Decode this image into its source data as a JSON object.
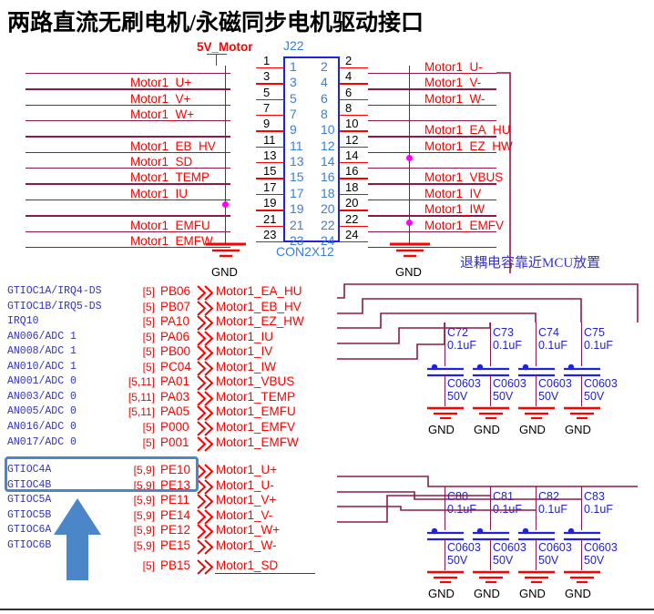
{
  "title": "两路直流无刷电机/永磁同步电机驱动接口",
  "power": {
    "label": "5V_Motor"
  },
  "connector": {
    "designator": "J22",
    "footprint": "CON2X12",
    "left_pins": [
      "1",
      "3",
      "5",
      "7",
      "9",
      "11",
      "13",
      "15",
      "17",
      "19",
      "21",
      "23"
    ],
    "right_pins": [
      "2",
      "4",
      "6",
      "8",
      "10",
      "12",
      "14",
      "16",
      "18",
      "20",
      "22",
      "24"
    ],
    "left_outer_numbers": [
      "1",
      "3",
      "5",
      "7",
      "9",
      "11",
      "13",
      "15",
      "17",
      "19",
      "21",
      "23"
    ],
    "right_outer_numbers": [
      "2",
      "4",
      "6",
      "8",
      "10",
      "12",
      "14",
      "16",
      "18",
      "20",
      "22",
      "24"
    ],
    "left_nets": [
      "",
      "Motor1_U+",
      "Motor1_V+",
      "Motor1_W+",
      "",
      "Motor1_EB_HV",
      "Motor1_SD",
      "Motor1_TEMP",
      "Motor1_IU",
      "",
      "Motor1_EMFU",
      "Motor1_EMFW"
    ],
    "right_nets": [
      "Motor1_U-",
      "Motor1_V-",
      "Motor1_W-",
      "",
      "Motor1_EA_HU",
      "Motor1_EZ_HW",
      "",
      "Motor1_VBUS",
      "Motor1_IV",
      "Motor1_IW",
      "Motor1_EMFV",
      ""
    ]
  },
  "ground_labels": {
    "left": "GND",
    "right": "GND"
  },
  "note": "退耦电容靠近MCU放置",
  "mcu_pins": [
    {
      "func": "GTIOC1A/IRQ4-DS",
      "sheet": "[5]",
      "pin": "PB06",
      "net": "Motor1_EA_HU"
    },
    {
      "func": "GTIOC1B/IRQ5-DS",
      "sheet": "[5]",
      "pin": "PB07",
      "net": "Motor1_EB_HV"
    },
    {
      "func": "IRQ10",
      "sheet": "[5]",
      "pin": "PA10",
      "net": "Motor1_EZ_HW"
    },
    {
      "func": "AN006/ADC 1",
      "sheet": "[5]",
      "pin": "PA06",
      "net": "Motor1_IU"
    },
    {
      "func": "AN008/ADC 1",
      "sheet": "[5]",
      "pin": "PB00",
      "net": "Motor1_IV"
    },
    {
      "func": "AN010/ADC 1",
      "sheet": "[5]",
      "pin": "PC04",
      "net": "Motor1_IW"
    },
    {
      "func": "AN001/ADC 0",
      "sheet": "[5,11]",
      "pin": "PA01",
      "net": "Motor1_VBUS"
    },
    {
      "func": "AN003/ADC 0",
      "sheet": "[5,11]",
      "pin": "PA03",
      "net": "Motor1_TEMP"
    },
    {
      "func": "AN005/ADC 0",
      "sheet": "[5,11]",
      "pin": "PA05",
      "net": "Motor1_EMFU"
    },
    {
      "func": "AN016/ADC 0",
      "sheet": "[5]",
      "pin": "P000",
      "net": "Motor1_EMFV"
    },
    {
      "func": "AN017/ADC 0",
      "sheet": "[5]",
      "pin": "P001",
      "net": "Motor1_EMFW"
    }
  ],
  "gtioc_pins": [
    {
      "func": "GTIOC4A",
      "sheet": "[5,9]",
      "pin": "PE10",
      "net": "Motor1_U+",
      "highlighted": true
    },
    {
      "func": "GTIOC4B",
      "sheet": "[5,9]",
      "pin": "PE13",
      "net": "Motor1_U-",
      "highlighted": true
    },
    {
      "func": "GTIOC5A",
      "sheet": "[5,9]",
      "pin": "PE11",
      "net": "Motor1_V+",
      "highlighted": false
    },
    {
      "func": "GTIOC5B",
      "sheet": "[5,9]",
      "pin": "PE14",
      "net": "Motor1_V-",
      "highlighted": false
    },
    {
      "func": "GTIOC6A",
      "sheet": "[5,9]",
      "pin": "PE12",
      "net": "Motor1_W+",
      "highlighted": false
    },
    {
      "func": "GTIOC6B",
      "sheet": "[5,9]",
      "pin": "PE15",
      "net": "Motor1_W-",
      "highlighted": false
    }
  ],
  "sd_pin": {
    "func": "",
    "sheet": "[5]",
    "pin": "PB15",
    "net": "Motor1_SD"
  },
  "capacitors_top": [
    {
      "ref": "C72",
      "value": "0.1uF",
      "package": "C0603",
      "voltage": "50V",
      "gnd": "GND"
    },
    {
      "ref": "C73",
      "value": "0.1uF",
      "package": "C0603",
      "voltage": "50V",
      "gnd": "GND"
    },
    {
      "ref": "C74",
      "value": "0.1uF",
      "package": "C0603",
      "voltage": "50V",
      "gnd": "GND"
    },
    {
      "ref": "C75",
      "value": "0.1uF",
      "package": "C0603",
      "voltage": "50V",
      "gnd": "GND"
    }
  ],
  "capacitors_bottom": [
    {
      "ref": "C80",
      "value": "0.1uF",
      "package": "C0603",
      "voltage": "50V",
      "gnd": "GND"
    },
    {
      "ref": "C81",
      "value": "0.1uF",
      "package": "C0603",
      "voltage": "50V",
      "gnd": "GND"
    },
    {
      "ref": "C82",
      "value": "0.1uF",
      "package": "C0603",
      "voltage": "50V",
      "gnd": "GND"
    },
    {
      "ref": "C83",
      "value": "0.1uF",
      "package": "C0603",
      "voltage": "50V",
      "gnd": "GND"
    }
  ],
  "colors": {
    "net_red": "#ff0000",
    "wire_maroon": "#8b1a4a",
    "symbol_blue": "#2222dd",
    "junction_magenta": "#ff00ff",
    "highlight_blue": "#4a86c8",
    "note_blue": "#3333cc"
  }
}
